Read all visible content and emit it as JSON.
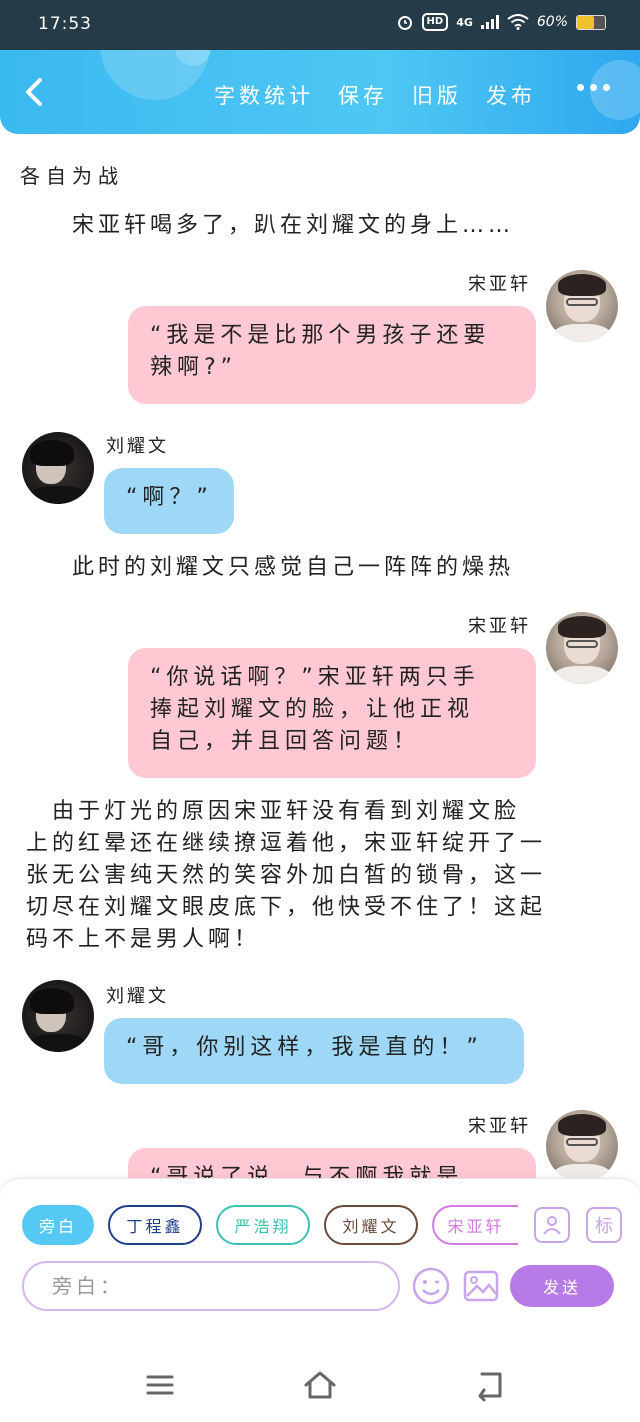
{
  "status_bar": {
    "time": "17:53",
    "network": "4G",
    "hd": "HD",
    "battery": "60%",
    "battery_level": 0.6
  },
  "header": {
    "back_icon": "chevron-left-icon",
    "actions": [
      "字数统计",
      "保存",
      "旧版",
      "发布"
    ],
    "more_icon": "more-dots-icon",
    "colors": {
      "gradient_start": "#3ab9f0",
      "gradient_end": "#2ea8ef"
    }
  },
  "story": {
    "title": "各自为战",
    "narration_1": "宋亚轩喝多了，趴在刘耀文的身上……",
    "messages": [
      {
        "speaker": "宋亚轩",
        "side": "right",
        "text_lines": [
          "“我是不是比那个男孩子还要",
          "辣啊?”"
        ],
        "color": "#ffc8d3"
      },
      {
        "speaker": "刘耀文",
        "side": "left",
        "text_lines": [
          "“啊？”"
        ],
        "color": "#9fd8f6"
      },
      {
        "speaker": "宋亚轩",
        "side": "right",
        "text_lines": [
          "“你说话啊？”宋亚轩两只手",
          "捧起刘耀文的脸，让他正视",
          "自己，并且回答问题！"
        ],
        "color": "#ffc8d3"
      },
      {
        "speaker": "刘耀文",
        "side": "left",
        "text_lines": [
          "“哥，你别这样，我是直的！”"
        ],
        "color": "#9fd8f6"
      },
      {
        "speaker": "宋亚轩",
        "side": "right",
        "text_lines": [
          "“哥说了说，与不啊我就是..."
        ],
        "color": "#ffc8d3"
      }
    ],
    "narration_2": "此时的刘耀文只感觉自己一阵阵的燥热",
    "narration_3_lines": [
      "　由于灯光的原因宋亚轩没有看到刘耀文脸",
      "上的红晕还在继续撩逗着他，宋亚轩绽开了一",
      "张无公害纯天然的笑容外加白皙的锁骨，这一",
      "切尽在刘耀文眼皮底下，他快受不住了！这起",
      "码不上不是男人啊！"
    ]
  },
  "composer": {
    "roles": [
      {
        "label": "旁白",
        "color": "#55c9f3",
        "active": true
      },
      {
        "label": "丁程鑫",
        "color": "#1f3f8a",
        "active": false
      },
      {
        "label": "严浩翔",
        "color": "#3cc2b4",
        "active": false
      },
      {
        "label": "刘耀文",
        "color": "#6b4a3a",
        "active": false
      },
      {
        "label": "宋亚轩",
        "color": "#d27be0",
        "active": false
      }
    ],
    "role_icon": "add-role-icon",
    "tag_label": "标",
    "input_placeholder": "旁白：",
    "emoji_icon": "emoji-icon",
    "image_icon": "image-icon",
    "send_label": "发送",
    "send_color": "#b67be6"
  },
  "nav_bar": {
    "menu_icon": "menu-icon",
    "home_icon": "home-icon",
    "back_icon": "back-icon"
  }
}
